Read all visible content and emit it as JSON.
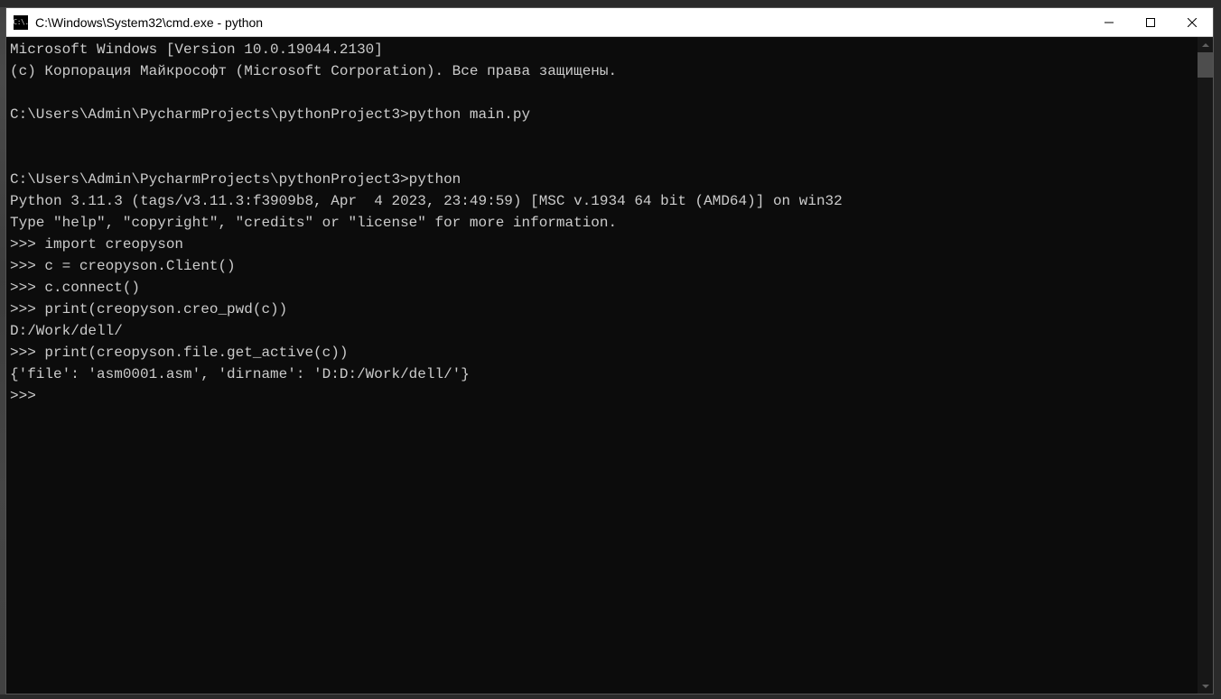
{
  "window": {
    "title": "C:\\Windows\\System32\\cmd.exe - python",
    "icon_label": "C:\\."
  },
  "terminal": {
    "lines": [
      "Microsoft Windows [Version 10.0.19044.2130]",
      "(c) Корпорация Майкрософт (Microsoft Corporation). Все права защищены.",
      "",
      "C:\\Users\\Admin\\PycharmProjects\\pythonProject3>python main.py",
      "",
      "",
      "C:\\Users\\Admin\\PycharmProjects\\pythonProject3>python",
      "Python 3.11.3 (tags/v3.11.3:f3909b8, Apr  4 2023, 23:49:59) [MSC v.1934 64 bit (AMD64)] on win32",
      "Type \"help\", \"copyright\", \"credits\" or \"license\" for more information.",
      ">>> import creopyson",
      ">>> c = creopyson.Client()",
      ">>> c.connect()",
      ">>> print(creopyson.creo_pwd(c))",
      "D:/Work/dell/",
      ">>> print(creopyson.file.get_active(c))",
      "{'file': 'asm0001.asm', 'dirname': 'D:D:/Work/dell/'}",
      ">>>"
    ]
  }
}
